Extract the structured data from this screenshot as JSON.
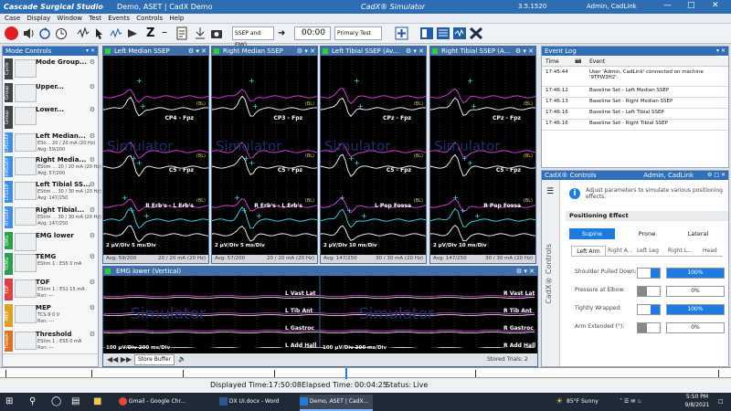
{
  "window": {
    "app_name": "Cascade Surgical Studio",
    "doc_title": "Demo, ASET | CadX Demo",
    "simulator": "CadX® Simulator",
    "version": "3.5.1520",
    "user": "Admin, CadLink"
  },
  "menu": [
    "Case",
    "Display",
    "Window",
    "Test",
    "Events",
    "Controls",
    "Help"
  ],
  "toolbar": {
    "mode_select": "SSEP and EMG",
    "time": "00:00",
    "test_select": "Primary Test"
  },
  "modes": {
    "title": "Mode Controls",
    "items": [
      {
        "tag": "Cycle",
        "tag_color": "#444444",
        "name": "Mode Group...",
        "lines": []
      },
      {
        "tag": "Group",
        "tag_color": "#444444",
        "name": "Upper...",
        "lines": []
      },
      {
        "tag": "Group",
        "tag_color": "#444444",
        "name": "Lower...",
        "lines": []
      },
      {
        "tag": "LMSSEP",
        "tag_color": "#3f8ee8",
        "name": "Left Median...",
        "lines": [
          "ESti... 20 / 20 mA (20 Hz)",
          "Avg: 59/200"
        ]
      },
      {
        "tag": "RMSSEP",
        "tag_color": "#3f8ee8",
        "name": "Right Media...",
        "lines": [
          "EStim ... 20 / 20 mA (20 Hz)",
          "Avg: 57/200"
        ]
      },
      {
        "tag": "LTSSEP",
        "tag_color": "#3f8ee8",
        "name": "Left Tibial SS...",
        "lines": [
          "EStim ... 30 / 30 mA (20 Hz)",
          "Avg: 147/250"
        ]
      },
      {
        "tag": "RTSSEP",
        "tag_color": "#3f8ee8",
        "name": "Right Tibial...",
        "lines": [
          "EStim ... 30 / 30 mA (20 Hz)",
          "Avg: 147/250"
        ]
      },
      {
        "tag": "EMG",
        "tag_color": "#2aa04a",
        "name": "EMG lower",
        "lines": []
      },
      {
        "tag": "TEMG",
        "tag_color": "#2aa04a",
        "name": "TEMG",
        "lines": [
          "EStim 1 : ES5     0 mA"
        ]
      },
      {
        "tag": "TOF",
        "tag_color": "#e04040",
        "name": "TOF",
        "lines": [
          "EStim 1 : ES1     15 mA",
          "Rsn: ---"
        ]
      },
      {
        "tag": "MEP",
        "tag_color": "#e0a020",
        "name": "MEP",
        "lines": [
          "TCS-9     0 V",
          "Rsn: ---"
        ]
      },
      {
        "tag": "Thresh",
        "tag_color": "#e07020",
        "name": "Threshold",
        "lines": [
          "EStim 1 : ES5     0 mA",
          "Rsn: ---"
        ]
      }
    ]
  },
  "traces": [
    {
      "title": "Left Median SSEP",
      "labels": [
        "CP4 - Fpz",
        "C5 - Fpz",
        "R Erb's - L Erb's"
      ],
      "scale": "2 µV/Div   5 ms/Div",
      "footer_left": "Avg: 59/200",
      "footer_right": "20 / 20 mA (20 Hz)"
    },
    {
      "title": "Right Median SSEP",
      "labels": [
        "CP3 - Fpz",
        "C5 - Fpz",
        "R Erb's - L Erb's"
      ],
      "scale": "2 µV/Div   5 ms/Div",
      "footer_left": "Avg: 57/200",
      "footer_right": "20 / 20 mA (20 Hz)"
    },
    {
      "title": "Left Tibial SSEP (Av...",
      "labels": [
        "CPz - Fpz",
        "C5 - Fpz",
        "L Pop Fossa"
      ],
      "scale": "2 µV/Div   10 ms/Div",
      "footer_left": "Avg: 147/250",
      "footer_right": "30 / 30 mA (20 Hz)"
    },
    {
      "title": "Right Tibial SSEP (A...",
      "labels": [
        "CPz - Fpz",
        "C5 - Fpz",
        "R Pop Fossa"
      ],
      "scale": "2 µV/Div   10 ms/Div",
      "footer_left": "Avg: 147/250",
      "footer_right": "30 / 30 mA (20 Hz)"
    }
  ],
  "baseline_tag": "(BL)",
  "watermark": "Simulator",
  "emg": {
    "title": "EMG lower (Vertical)",
    "left_labels": [
      "L Vast Lat",
      "L Tib Ant",
      "L Gastroc",
      "L Add Hall"
    ],
    "right_labels": [
      "R Vast Lat",
      "R Tib Ant",
      "R Gastroc",
      "R Add Hall"
    ],
    "scale_left": "100 µV/Div   200 ms/Div",
    "scale_right": "100 µV/Div   200 ms/Div",
    "store_button": "Store Buffer",
    "stored_trials": "Stored Trials: 2"
  },
  "event_log": {
    "title": "Event Log",
    "col_time": "Time",
    "col_event": "Event",
    "rows": [
      {
        "time": "17:45:44",
        "event": "User 'Admin, CadLink' connected on machine '9TPW3H2'."
      },
      {
        "time": "17:46:12",
        "event": "Baseline Set - Left Median SSEP"
      },
      {
        "time": "17:46:13",
        "event": "Baseline Set - Right Median SSEP"
      },
      {
        "time": "17:46:16",
        "event": "Baseline Set - Left Tibial SSEP"
      },
      {
        "time": "17:46:16",
        "event": "Baseline Set - Right Tibial SSEP"
      }
    ]
  },
  "controls": {
    "title": "CadX® Controls",
    "user": "Admin, CadLink",
    "side_label": "CadX® Controls",
    "info": "Adjust parameters to simulate various positioning effects.",
    "section": "Positioning Effect",
    "positions": [
      "Supine",
      "Prone",
      "Lateral"
    ],
    "limb_tabs": [
      "Left Arm",
      "Right A...",
      "Left Leg",
      "Right L...",
      "Head"
    ],
    "params": [
      {
        "label": "Shoulder Pulled Down:",
        "value": "100%",
        "fill": 1.0
      },
      {
        "label": "Pressure at Elbow:",
        "value": "0%",
        "fill": 0.0
      },
      {
        "label": "Tightly Wrapped:",
        "value": "100%",
        "fill": 1.0
      },
      {
        "label": "Arm Extended (°):",
        "value": "0%",
        "fill": 0.0
      }
    ]
  },
  "status": {
    "displayed_label": "Displayed Time:",
    "displayed": "17:50:08",
    "elapsed_label": "Elapsed Time:",
    "elapsed": "00:04:25",
    "status_label": "Status:",
    "status": "Live"
  },
  "taskbar": {
    "apps": [
      "Gmail - Google Chr...",
      "DX UI.docx - Word",
      "Demo, ASET | CadX..."
    ],
    "weather": "85°F  Sunny",
    "time": "5:50 PM",
    "date": "9/8/2021"
  },
  "colors": {
    "title_blue": "#2c6db3",
    "trace_magenta": "#e040e0",
    "trace_cyan": "#40e0f0",
    "trace_white": "#ffffff",
    "accent_blue": "#1e7be0"
  }
}
